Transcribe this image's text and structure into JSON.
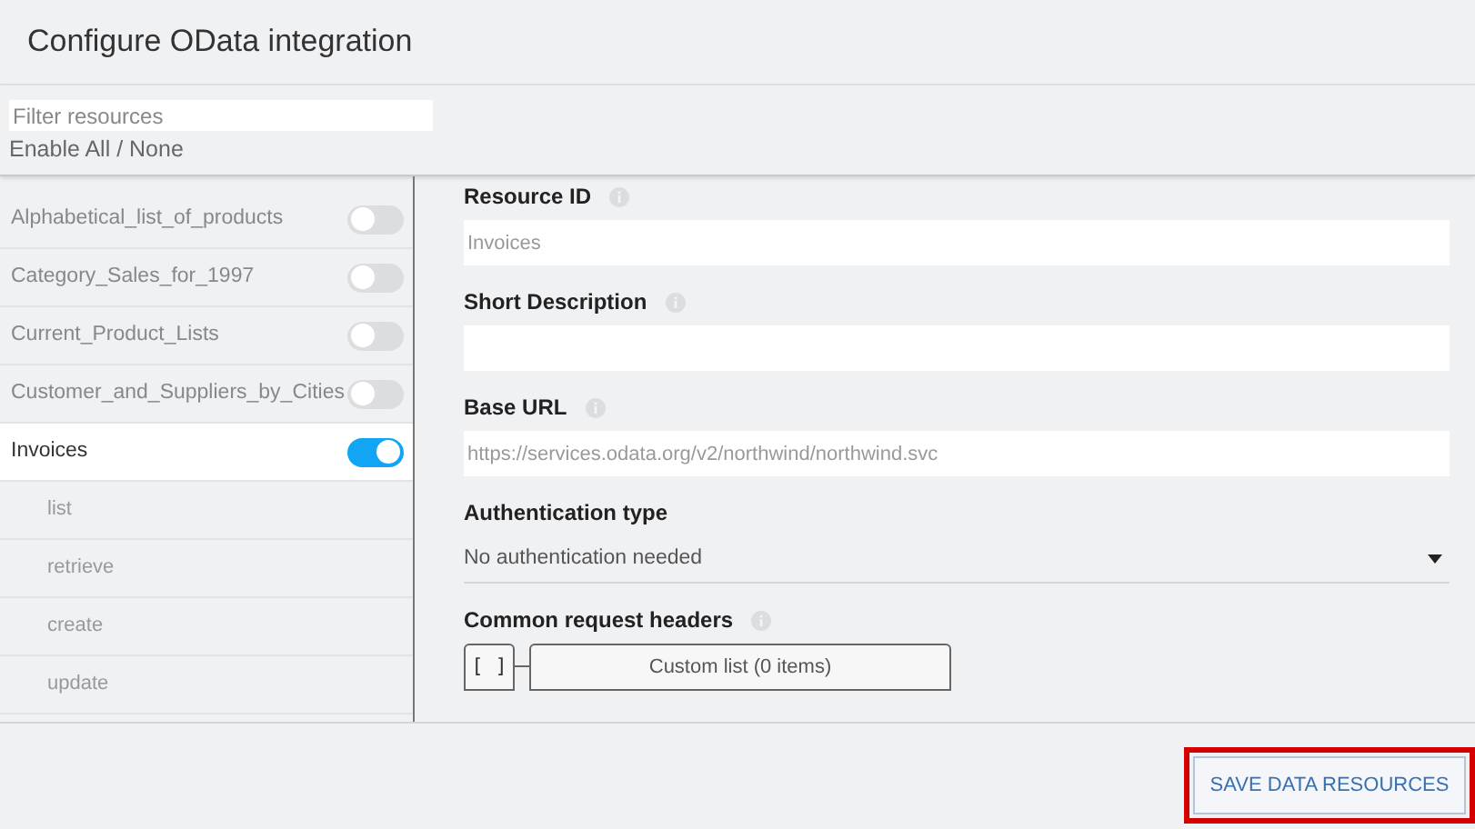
{
  "title": "Configure OData integration",
  "filter": {
    "placeholder": "Filter resources"
  },
  "enable_all_none": "Enable All / None",
  "resources": [
    {
      "label": "Alphabetical_list_of_products",
      "on": false,
      "selected": false
    },
    {
      "label": "Category_Sales_for_1997",
      "on": false,
      "selected": false
    },
    {
      "label": "Current_Product_Lists",
      "on": false,
      "selected": false
    },
    {
      "label": "Customer_and_Suppliers_by_Cities",
      "on": false,
      "selected": false
    },
    {
      "label": "Invoices",
      "on": true,
      "selected": true,
      "children": [
        {
          "label": "list"
        },
        {
          "label": "retrieve"
        },
        {
          "label": "create"
        },
        {
          "label": "update"
        }
      ]
    }
  ],
  "form": {
    "fields": [
      {
        "kind": "input",
        "label": "Resource ID",
        "info": true,
        "placeholder": "Invoices"
      },
      {
        "kind": "input",
        "label": "Short Description",
        "info": true
      },
      {
        "kind": "input",
        "label": "Base URL",
        "info": true,
        "placeholder": "https://services.odata.org/v2/northwind/northwind.svc"
      },
      {
        "kind": "select",
        "label": "Authentication type",
        "info": false,
        "value": "No authentication needed"
      },
      {
        "kind": "list",
        "label": "Common request headers",
        "info": true,
        "toggle": "[ ]",
        "value": "Custom list (0 items)"
      }
    ]
  },
  "save_button": "SAVE DATA RESOURCES"
}
